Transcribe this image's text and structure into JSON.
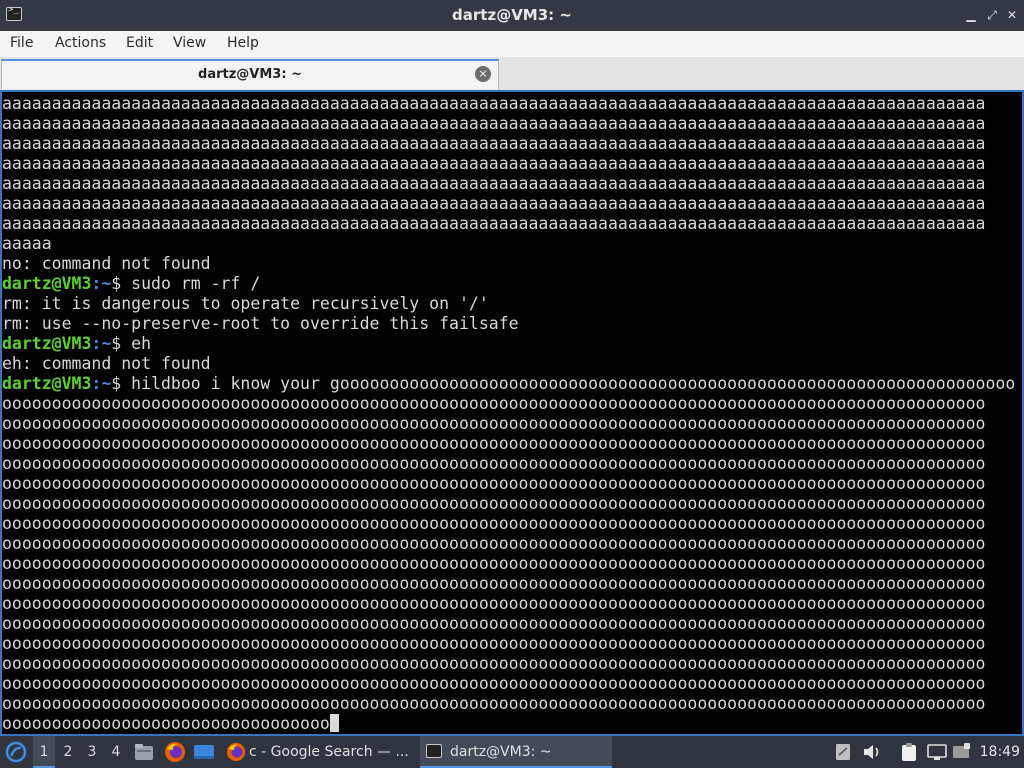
{
  "window": {
    "title": "dartz@VM3: ~",
    "min_glyph": "▁",
    "max_glyph": "⤢",
    "close_glyph": "✕"
  },
  "menu": {
    "file": "File",
    "actions": "Actions",
    "edit": "Edit",
    "view": "View",
    "help": "Help"
  },
  "tab": {
    "label": "dartz@VM3: ~",
    "close_glyph": "×"
  },
  "terminal": {
    "prompt_user": "dartz@VM3",
    "prompt_path": ":~",
    "prompt_symbol": "$ ",
    "lines": [
      {
        "type": "out",
        "text": "aaaaaaaaaaaaaaaaaaaaaaaaaaaaaaaaaaaaaaaaaaaaaaaaaaaaaaaaaaaaaaaaaaaaaaaaaaaaaaaaaaaaaaaaaaaaaaaaaaa"
      },
      {
        "type": "out",
        "text": "aaaaaaaaaaaaaaaaaaaaaaaaaaaaaaaaaaaaaaaaaaaaaaaaaaaaaaaaaaaaaaaaaaaaaaaaaaaaaaaaaaaaaaaaaaaaaaaaaaa"
      },
      {
        "type": "out",
        "text": "aaaaaaaaaaaaaaaaaaaaaaaaaaaaaaaaaaaaaaaaaaaaaaaaaaaaaaaaaaaaaaaaaaaaaaaaaaaaaaaaaaaaaaaaaaaaaaaaaaa"
      },
      {
        "type": "out",
        "text": "aaaaaaaaaaaaaaaaaaaaaaaaaaaaaaaaaaaaaaaaaaaaaaaaaaaaaaaaaaaaaaaaaaaaaaaaaaaaaaaaaaaaaaaaaaaaaaaaaaa"
      },
      {
        "type": "out",
        "text": "aaaaaaaaaaaaaaaaaaaaaaaaaaaaaaaaaaaaaaaaaaaaaaaaaaaaaaaaaaaaaaaaaaaaaaaaaaaaaaaaaaaaaaaaaaaaaaaaaaa"
      },
      {
        "type": "out",
        "text": "aaaaaaaaaaaaaaaaaaaaaaaaaaaaaaaaaaaaaaaaaaaaaaaaaaaaaaaaaaaaaaaaaaaaaaaaaaaaaaaaaaaaaaaaaaaaaaaaaaa"
      },
      {
        "type": "out",
        "text": "aaaaaaaaaaaaaaaaaaaaaaaaaaaaaaaaaaaaaaaaaaaaaaaaaaaaaaaaaaaaaaaaaaaaaaaaaaaaaaaaaaaaaaaaaaaaaaaaaaa"
      },
      {
        "type": "out",
        "text": "aaaaa"
      },
      {
        "type": "out",
        "text": "no: command not found"
      },
      {
        "type": "prompt",
        "cmd": "sudo rm -rf /"
      },
      {
        "type": "out",
        "text": "rm: it is dangerous to operate recursively on '/'"
      },
      {
        "type": "out",
        "text": "rm: use --no-preserve-root to override this failsafe"
      },
      {
        "type": "prompt",
        "cmd": "eh"
      },
      {
        "type": "out",
        "text": "eh: command not found"
      },
      {
        "type": "prompt",
        "cmd": "hildboo i know your goooooooooooooooooooooooooooooooooooooooooooooooooooooooooooooooooooo"
      },
      {
        "type": "out",
        "text": "ooooooooooooooooooooooooooooooooooooooooooooooooooooooooooooooooooooooooooooooooooooooooooooooooooo"
      },
      {
        "type": "out",
        "text": "ooooooooooooooooooooooooooooooooooooooooooooooooooooooooooooooooooooooooooooooooooooooooooooooooooo"
      },
      {
        "type": "out",
        "text": "ooooooooooooooooooooooooooooooooooooooooooooooooooooooooooooooooooooooooooooooooooooooooooooooooooo"
      },
      {
        "type": "out",
        "text": "ooooooooooooooooooooooooooooooooooooooooooooooooooooooooooooooooooooooooooooooooooooooooooooooooooo"
      },
      {
        "type": "out",
        "text": "ooooooooooooooooooooooooooooooooooooooooooooooooooooooooooooooooooooooooooooooooooooooooooooooooooo"
      },
      {
        "type": "out",
        "text": "ooooooooooooooooooooooooooooooooooooooooooooooooooooooooooooooooooooooooooooooooooooooooooooooooooo"
      },
      {
        "type": "out",
        "text": "ooooooooooooooooooooooooooooooooooooooooooooooooooooooooooooooooooooooooooooooooooooooooooooooooooo"
      },
      {
        "type": "out",
        "text": "ooooooooooooooooooooooooooooooooooooooooooooooooooooooooooooooooooooooooooooooooooooooooooooooooooo"
      },
      {
        "type": "out",
        "text": "ooooooooooooooooooooooooooooooooooooooooooooooooooooooooooooooooooooooooooooooooooooooooooooooooooo"
      },
      {
        "type": "out",
        "text": "ooooooooooooooooooooooooooooooooooooooooooooooooooooooooooooooooooooooooooooooooooooooooooooooooooo"
      },
      {
        "type": "out",
        "text": "ooooooooooooooooooooooooooooooooooooooooooooooooooooooooooooooooooooooooooooooooooooooooooooooooooo"
      },
      {
        "type": "out",
        "text": "ooooooooooooooooooooooooooooooooooooooooooooooooooooooooooooooooooooooooooooooooooooooooooooooooooo"
      },
      {
        "type": "out",
        "text": "ooooooooooooooooooooooooooooooooooooooooooooooooooooooooooooooooooooooooooooooooooooooooooooooooooo"
      },
      {
        "type": "out",
        "text": "ooooooooooooooooooooooooooooooooooooooooooooooooooooooooooooooooooooooooooooooooooooooooooooooooooo"
      },
      {
        "type": "out",
        "text": "ooooooooooooooooooooooooooooooooooooooooooooooooooooooooooooooooooooooooooooooooooooooooooooooooooo"
      },
      {
        "type": "out",
        "text": "ooooooooooooooooooooooooooooooooooooooooooooooooooooooooooooooooooooooooooooooooooooooooooooooooooo"
      },
      {
        "type": "cursor",
        "text": "ooooooooooooooooooooooooooooooooo"
      }
    ]
  },
  "taskbar": {
    "workspaces": [
      "1",
      "2",
      "3",
      "4"
    ],
    "active_workspace": "1",
    "browser_task": "c - Google Search — ...",
    "terminal_task": "dartz@VM3: ~",
    "clock": "18:49",
    "icons": [
      "distro-logo-icon",
      "files-icon",
      "firefox-icon",
      "show-desktop-icon",
      "firefox-task-icon",
      "terminal-task-icon",
      "notes-icon",
      "volume-icon",
      "clipboard-icon",
      "network-icon"
    ]
  },
  "colors": {
    "prompt_user": "#5bd22e",
    "prompt_path": "#4a86e8",
    "terminal_fg": "#d9d9d9",
    "terminal_bg": "#000000",
    "accent": "#5294e2"
  }
}
